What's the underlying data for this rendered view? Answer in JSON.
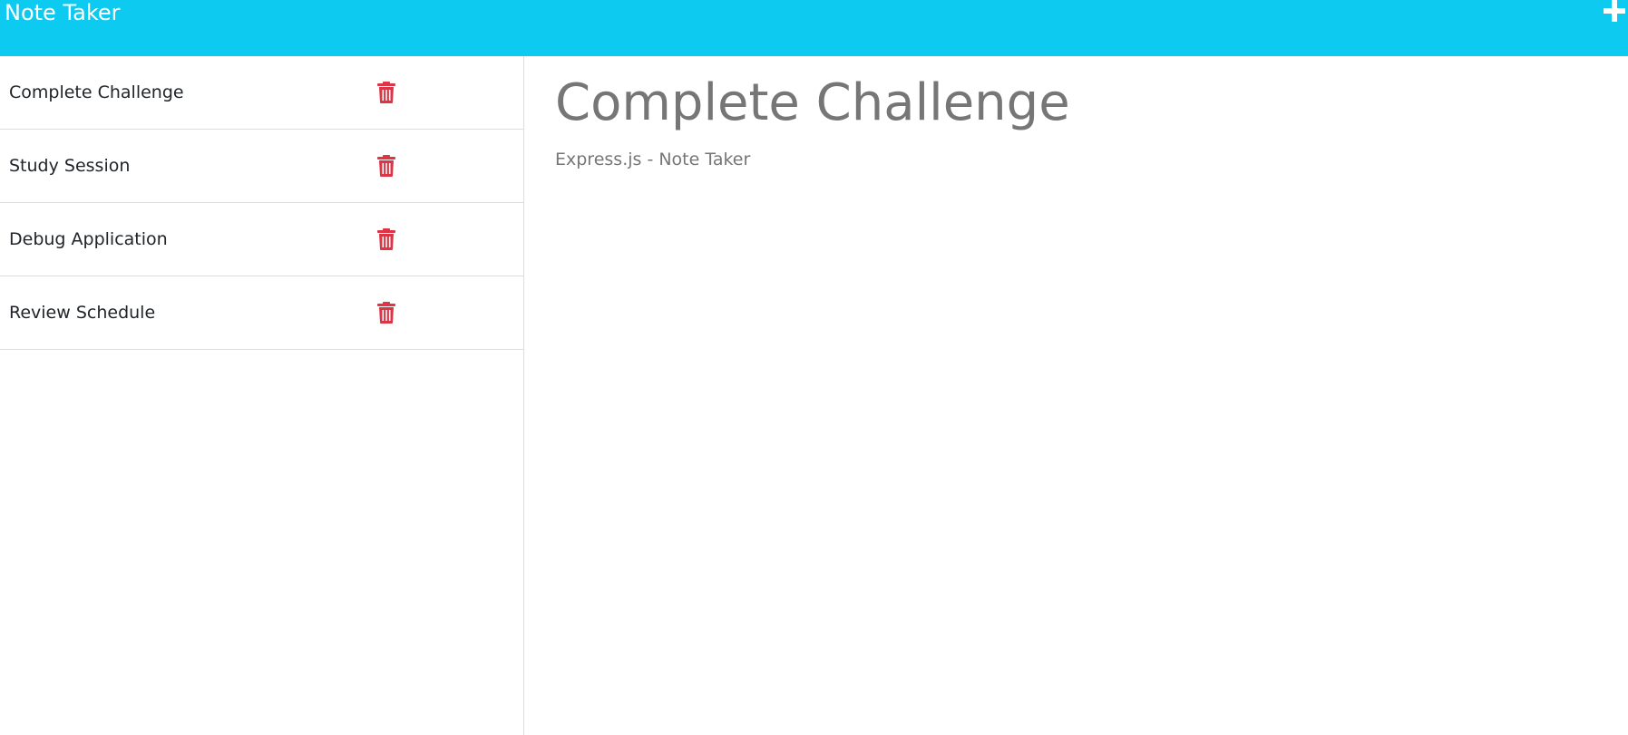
{
  "header": {
    "brand": "Note Taker",
    "new_note_icon": "plus-icon"
  },
  "sidebar": {
    "delete_icon": "trash-icon",
    "notes": [
      {
        "title": "Complete Challenge"
      },
      {
        "title": "Study Session"
      },
      {
        "title": "Debug Application"
      },
      {
        "title": "Review Schedule"
      }
    ]
  },
  "editor": {
    "title": "Complete Challenge",
    "text": "Express.js - Note Taker"
  },
  "colors": {
    "navbar": "#0dcaf0",
    "delete": "#dc3545",
    "editor_text": "#767676"
  }
}
